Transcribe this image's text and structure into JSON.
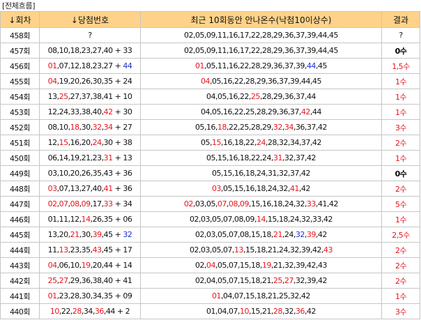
{
  "title": "[전체흐름]",
  "headers": {
    "round": "↓회차",
    "winning": "↓당첨번호",
    "recent": "최근 10회동안 안나온수(낙첨10이상수)",
    "result": "결과"
  },
  "colors": {
    "hit": "#e8141c",
    "bonus_hit": "#1a2fd0",
    "header_bg": "#ffd28a"
  },
  "rows": [
    {
      "round": "458회",
      "winning": [
        {
          "t": "?",
          "c": ""
        }
      ],
      "recent": [
        {
          "t": "02,05,09,11,16,17,22,28,29,36,37,39,44,45",
          "c": ""
        }
      ],
      "result": "?",
      "result_style": "plain"
    },
    {
      "round": "457회",
      "winning": [
        {
          "t": "08,10,18,23,27,40 + 33",
          "c": ""
        }
      ],
      "recent": [
        {
          "t": "02,05,09,11,16,17,22,28,29,36,37,39,44,45",
          "c": ""
        }
      ],
      "result": "0수",
      "result_style": "bold"
    },
    {
      "round": "456회",
      "winning": [
        {
          "t": "01",
          "c": "red"
        },
        {
          "t": ",07,12,18,23,27 + ",
          "c": ""
        },
        {
          "t": "44",
          "c": "blue"
        }
      ],
      "recent": [
        {
          "t": "01",
          "c": "red"
        },
        {
          "t": ",05,11,16,22,28,29,36,37,39,",
          "c": ""
        },
        {
          "t": "44",
          "c": "blue"
        },
        {
          "t": ",45",
          "c": ""
        }
      ],
      "result": "1,5수",
      "result_style": "red"
    },
    {
      "round": "455회",
      "winning": [
        {
          "t": "04",
          "c": "red"
        },
        {
          "t": ",19,20,26,30,35 + 24",
          "c": ""
        }
      ],
      "recent": [
        {
          "t": "04",
          "c": "red"
        },
        {
          "t": ",05,16,22,28,29,36,37,39,44,45",
          "c": ""
        }
      ],
      "result": "1수",
      "result_style": "red"
    },
    {
      "round": "454회",
      "winning": [
        {
          "t": "13,",
          "c": ""
        },
        {
          "t": "25",
          "c": "red"
        },
        {
          "t": ",27,37,38,41 + 10",
          "c": ""
        }
      ],
      "recent": [
        {
          "t": "04,05,16,22,",
          "c": ""
        },
        {
          "t": "25",
          "c": "red"
        },
        {
          "t": ",28,29,36,37,44",
          "c": ""
        }
      ],
      "result": "1수",
      "result_style": "red"
    },
    {
      "round": "453회",
      "winning": [
        {
          "t": "12,24,33,38,40,",
          "c": ""
        },
        {
          "t": "42",
          "c": "red"
        },
        {
          "t": " + 30",
          "c": ""
        }
      ],
      "recent": [
        {
          "t": "04,05,16,22,25,28,29,36,37,",
          "c": ""
        },
        {
          "t": "42",
          "c": "red"
        },
        {
          "t": ",44",
          "c": ""
        }
      ],
      "result": "1수",
      "result_style": "red"
    },
    {
      "round": "452회",
      "winning": [
        {
          "t": "08,10,",
          "c": ""
        },
        {
          "t": "18",
          "c": "red"
        },
        {
          "t": ",30,",
          "c": ""
        },
        {
          "t": "32",
          "c": "red"
        },
        {
          "t": ",",
          "c": ""
        },
        {
          "t": "34",
          "c": "red"
        },
        {
          "t": " + 27",
          "c": ""
        }
      ],
      "recent": [
        {
          "t": "05,16,",
          "c": ""
        },
        {
          "t": "18",
          "c": "red"
        },
        {
          "t": ",22,25,28,29,",
          "c": ""
        },
        {
          "t": "32",
          "c": "red"
        },
        {
          "t": ",",
          "c": ""
        },
        {
          "t": "34",
          "c": "red"
        },
        {
          "t": ",36,37,42",
          "c": ""
        }
      ],
      "result": "3수",
      "result_style": "red"
    },
    {
      "round": "451회",
      "winning": [
        {
          "t": "12,",
          "c": ""
        },
        {
          "t": "15",
          "c": "red"
        },
        {
          "t": ",16,20,",
          "c": ""
        },
        {
          "t": "24",
          "c": "red"
        },
        {
          "t": ",30 + 38",
          "c": ""
        }
      ],
      "recent": [
        {
          "t": "05,",
          "c": ""
        },
        {
          "t": "15",
          "c": "red"
        },
        {
          "t": ",16,18,22,",
          "c": ""
        },
        {
          "t": "24",
          "c": "red"
        },
        {
          "t": ",28,32,34,37,42",
          "c": ""
        }
      ],
      "result": "2수",
      "result_style": "red"
    },
    {
      "round": "450회",
      "winning": [
        {
          "t": "06,14,19,21,23,",
          "c": ""
        },
        {
          "t": "31",
          "c": "red"
        },
        {
          "t": " + 13",
          "c": ""
        }
      ],
      "recent": [
        {
          "t": "05,15,16,18,22,24,",
          "c": ""
        },
        {
          "t": "31",
          "c": "red"
        },
        {
          "t": ",32,37,42",
          "c": ""
        }
      ],
      "result": "1수",
      "result_style": "red"
    },
    {
      "round": "449회",
      "winning": [
        {
          "t": "03,10,20,26,35,43 + 36",
          "c": ""
        }
      ],
      "recent": [
        {
          "t": "05,15,16,18,24,31,32,37,42",
          "c": ""
        }
      ],
      "result": "0수",
      "result_style": "bold"
    },
    {
      "round": "448회",
      "winning": [
        {
          "t": "03",
          "c": "red"
        },
        {
          "t": ",07,13,27,40,",
          "c": ""
        },
        {
          "t": "41",
          "c": "red"
        },
        {
          "t": " + 36",
          "c": ""
        }
      ],
      "recent": [
        {
          "t": "03",
          "c": "red"
        },
        {
          "t": ",05,15,16,18,24,32,",
          "c": ""
        },
        {
          "t": "41",
          "c": "red"
        },
        {
          "t": ",42",
          "c": ""
        }
      ],
      "result": "2수",
      "result_style": "red"
    },
    {
      "round": "447회",
      "winning": [
        {
          "t": "02",
          "c": "red"
        },
        {
          "t": ",",
          "c": ""
        },
        {
          "t": "07",
          "c": "red"
        },
        {
          "t": ",",
          "c": ""
        },
        {
          "t": "08",
          "c": "red"
        },
        {
          "t": ",",
          "c": ""
        },
        {
          "t": "09",
          "c": "red"
        },
        {
          "t": ",17,",
          "c": ""
        },
        {
          "t": "33",
          "c": "red"
        },
        {
          "t": " + 34",
          "c": ""
        }
      ],
      "recent": [
        {
          "t": "02",
          "c": "red"
        },
        {
          "t": ",03,05,",
          "c": ""
        },
        {
          "t": "07",
          "c": "red"
        },
        {
          "t": ",",
          "c": ""
        },
        {
          "t": "08",
          "c": "red"
        },
        {
          "t": ",",
          "c": ""
        },
        {
          "t": "09",
          "c": "red"
        },
        {
          "t": ",15,16,18,24,32,",
          "c": ""
        },
        {
          "t": "33",
          "c": "red"
        },
        {
          "t": ",41,42",
          "c": ""
        }
      ],
      "result": "5수",
      "result_style": "red"
    },
    {
      "round": "446회",
      "winning": [
        {
          "t": "01,11,12,",
          "c": ""
        },
        {
          "t": "14",
          "c": "red"
        },
        {
          "t": ",26,35 + 06",
          "c": ""
        }
      ],
      "recent": [
        {
          "t": "02,03,05,07,08,09,",
          "c": ""
        },
        {
          "t": "14",
          "c": "red"
        },
        {
          "t": ",15,18,24,32,33,42",
          "c": ""
        }
      ],
      "result": "1수",
      "result_style": "red"
    },
    {
      "round": "445회",
      "winning": [
        {
          "t": "13,20,",
          "c": ""
        },
        {
          "t": "21",
          "c": "red"
        },
        {
          "t": ",30,",
          "c": ""
        },
        {
          "t": "39",
          "c": "red"
        },
        {
          "t": ",45 + ",
          "c": ""
        },
        {
          "t": "32",
          "c": "blue"
        }
      ],
      "recent": [
        {
          "t": "02,03,05,07,08,15,18,",
          "c": ""
        },
        {
          "t": "21",
          "c": "red"
        },
        {
          "t": ",24,",
          "c": ""
        },
        {
          "t": "32",
          "c": "blue"
        },
        {
          "t": ",",
          "c": ""
        },
        {
          "t": "39",
          "c": "red"
        },
        {
          "t": ",42",
          "c": ""
        }
      ],
      "result": "2,5수",
      "result_style": "red"
    },
    {
      "round": "444회",
      "winning": [
        {
          "t": "11,",
          "c": ""
        },
        {
          "t": "13",
          "c": "red"
        },
        {
          "t": ",23,35,",
          "c": ""
        },
        {
          "t": "43",
          "c": "red"
        },
        {
          "t": ",45 + 17",
          "c": ""
        }
      ],
      "recent": [
        {
          "t": "02,03,05,07,",
          "c": ""
        },
        {
          "t": "13",
          "c": "red"
        },
        {
          "t": ",15,18,21,24,32,39,42,",
          "c": ""
        },
        {
          "t": "43",
          "c": "red"
        }
      ],
      "result": "2수",
      "result_style": "red"
    },
    {
      "round": "443회",
      "winning": [
        {
          "t": "04",
          "c": "red"
        },
        {
          "t": ",06,10,",
          "c": ""
        },
        {
          "t": "19",
          "c": "red"
        },
        {
          "t": ",20,44 + 14",
          "c": ""
        }
      ],
      "recent": [
        {
          "t": "02,",
          "c": ""
        },
        {
          "t": "04",
          "c": "red"
        },
        {
          "t": ",05,07,15,18,",
          "c": ""
        },
        {
          "t": "19",
          "c": "red"
        },
        {
          "t": ",21,32,39,42,43",
          "c": ""
        }
      ],
      "result": "2수",
      "result_style": "red"
    },
    {
      "round": "442회",
      "winning": [
        {
          "t": "25",
          "c": "red"
        },
        {
          "t": ",",
          "c": ""
        },
        {
          "t": "27",
          "c": "red"
        },
        {
          "t": ",29,36,38,40 + 41",
          "c": ""
        }
      ],
      "recent": [
        {
          "t": "02,04,05,07,15,18,21,",
          "c": ""
        },
        {
          "t": "25",
          "c": "red"
        },
        {
          "t": ",",
          "c": ""
        },
        {
          "t": "27",
          "c": "red"
        },
        {
          "t": ",32,39,42",
          "c": ""
        }
      ],
      "result": "2수",
      "result_style": "red"
    },
    {
      "round": "441회",
      "winning": [
        {
          "t": "01",
          "c": "red"
        },
        {
          "t": ",23,28,30,34,35 + 09",
          "c": ""
        }
      ],
      "recent": [
        {
          "t": "01",
          "c": "red"
        },
        {
          "t": ",04,07,15,18,21,25,32,42",
          "c": ""
        }
      ],
      "result": "1수",
      "result_style": "red"
    },
    {
      "round": "440회",
      "winning": [
        {
          "t": "10",
          "c": "red"
        },
        {
          "t": ",22,",
          "c": ""
        },
        {
          "t": "28",
          "c": "red"
        },
        {
          "t": ",34,",
          "c": ""
        },
        {
          "t": "36",
          "c": "red"
        },
        {
          "t": ",44 + 2",
          "c": ""
        }
      ],
      "recent": [
        {
          "t": "01,04,07,",
          "c": ""
        },
        {
          "t": "10",
          "c": "red"
        },
        {
          "t": ",15,21,",
          "c": ""
        },
        {
          "t": "28",
          "c": "red"
        },
        {
          "t": ",32,",
          "c": ""
        },
        {
          "t": "36",
          "c": "red"
        },
        {
          "t": ",42",
          "c": ""
        }
      ],
      "result": "3수",
      "result_style": "red"
    }
  ]
}
